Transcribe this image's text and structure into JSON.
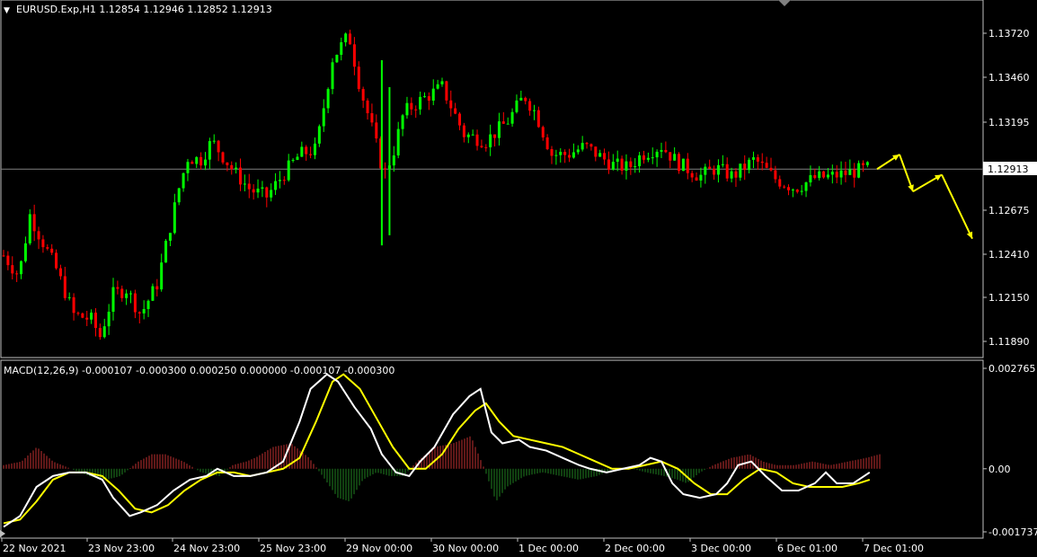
{
  "colors": {
    "background": "#000000",
    "frame": "#c0c0c0",
    "bull": "#00ff00",
    "bear": "#ff0000",
    "macd_line": "#ffffff",
    "signal_line": "#ffff00",
    "hist_up": "#c03030",
    "hist_down": "#208020",
    "arrow": "#ffff00",
    "price_line": "#808080"
  },
  "price_panel": {
    "header": "EURUSD.Exp,H1  1.12854 1.12946 1.12852 1.12913",
    "current_price": "1.12913",
    "y_ticks": [
      "1.13720",
      "1.13460",
      "1.13195",
      "1.12913",
      "1.12675",
      "1.12410",
      "1.12150",
      "1.11890"
    ]
  },
  "macd_panel": {
    "header": "MACD(12,26,9) -0.000107 -0.000300 0.000250 0.000000 -0.000107 -0.000300",
    "y_ticks": [
      "0.002765",
      "0.00",
      "-0.001737"
    ]
  },
  "x_ticks": [
    "22 Nov 2021",
    "23 Nov 23:00",
    "24 Nov 23:00",
    "25 Nov 23:00",
    "29 Nov 00:00",
    "30 Nov 00:00",
    "1 Dec 00:00",
    "2 Dec 00:00",
    "3 Dec 00:00",
    "6 Dec 01:00",
    "7 Dec 01:00"
  ],
  "chart_data": {
    "type": "candlestick",
    "symbol": "EURUSD.Exp",
    "timeframe": "H1",
    "ohlc_last": {
      "open": 1.12854,
      "high": 1.12946,
      "low": 1.12852,
      "close": 1.12913
    },
    "price_ylim": [
      1.1182,
      1.139
    ],
    "close_path": [
      [
        0,
        1.124
      ],
      [
        14,
        1.1228
      ],
      [
        24,
        1.1264
      ],
      [
        32,
        1.1253
      ],
      [
        48,
        1.1232
      ],
      [
        64,
        1.1205
      ],
      [
        80,
        1.1202
      ],
      [
        88,
        1.1192
      ],
      [
        100,
        1.1217
      ],
      [
        112,
        1.122
      ],
      [
        125,
        1.1205
      ],
      [
        140,
        1.1223
      ],
      [
        160,
        1.128
      ],
      [
        168,
        1.1298
      ],
      [
        180,
        1.1297
      ],
      [
        190,
        1.1308
      ],
      [
        210,
        1.129
      ],
      [
        225,
        1.1279
      ],
      [
        240,
        1.1275
      ],
      [
        255,
        1.1288
      ],
      [
        270,
        1.13
      ],
      [
        285,
        1.1303
      ],
      [
        300,
        1.1357
      ],
      [
        315,
        1.1371
      ],
      [
        325,
        1.134
      ],
      [
        335,
        1.1318
      ],
      [
        347,
        1.1288
      ],
      [
        355,
        1.13
      ],
      [
        365,
        1.1325
      ],
      [
        380,
        1.1332
      ],
      [
        400,
        1.134
      ],
      [
        420,
        1.1312
      ],
      [
        440,
        1.1308
      ],
      [
        460,
        1.132
      ],
      [
        475,
        1.1335
      ],
      [
        485,
        1.1325
      ],
      [
        500,
        1.13
      ],
      [
        515,
        1.13
      ],
      [
        530,
        1.1305
      ],
      [
        555,
        1.1294
      ],
      [
        570,
        1.1292
      ],
      [
        582,
        1.13
      ],
      [
        600,
        1.1305
      ],
      [
        615,
        1.1295
      ],
      [
        635,
        1.1287
      ],
      [
        650,
        1.1292
      ],
      [
        665,
        1.1287
      ],
      [
        685,
        1.1297
      ],
      [
        705,
        1.1285
      ],
      [
        722,
        1.128
      ],
      [
        740,
        1.1286
      ],
      [
        755,
        1.1287
      ],
      [
        770,
        1.1289
      ],
      [
        790,
        1.1292
      ]
    ],
    "shadow_spikes": [
      {
        "t": 345,
        "low": 1.1246,
        "high": 1.1356
      },
      {
        "t": 352,
        "low": 1.1252,
        "high": 1.134
      }
    ],
    "macd": {
      "params": "MACD(12,26,9)",
      "ylim": [
        -0.001737,
        0.002765
      ],
      "macd_line": [
        [
          0,
          -0.0016
        ],
        [
          15,
          -0.0013
        ],
        [
          30,
          -0.0005
        ],
        [
          45,
          -0.0002
        ],
        [
          60,
          -0.0001
        ],
        [
          75,
          -0.0001
        ],
        [
          90,
          -0.0003
        ],
        [
          100,
          -0.0008
        ],
        [
          115,
          -0.0013
        ],
        [
          125,
          -0.0012
        ],
        [
          140,
          -0.001
        ],
        [
          155,
          -0.0006
        ],
        [
          170,
          -0.0003
        ],
        [
          185,
          -0.0002
        ],
        [
          195,
          0.0
        ],
        [
          210,
          -0.0002
        ],
        [
          225,
          -0.0002
        ],
        [
          240,
          -0.0001
        ],
        [
          255,
          0.0002
        ],
        [
          270,
          0.0013
        ],
        [
          280,
          0.0022
        ],
        [
          295,
          0.0026
        ],
        [
          305,
          0.0024
        ],
        [
          320,
          0.0017
        ],
        [
          335,
          0.0011
        ],
        [
          345,
          0.0004
        ],
        [
          358,
          -0.0001
        ],
        [
          370,
          -0.0002
        ],
        [
          380,
          0.0002
        ],
        [
          393,
          0.0006
        ],
        [
          410,
          0.0015
        ],
        [
          425,
          0.002
        ],
        [
          435,
          0.0022
        ],
        [
          445,
          0.001
        ],
        [
          455,
          0.0007
        ],
        [
          470,
          0.0008
        ],
        [
          480,
          0.0006
        ],
        [
          495,
          0.0005
        ],
        [
          510,
          0.0003
        ],
        [
          525,
          0.0001
        ],
        [
          535,
          0.0
        ],
        [
          550,
          -0.0001
        ],
        [
          565,
          0.0
        ],
        [
          580,
          0.0001
        ],
        [
          590,
          0.0003
        ],
        [
          600,
          0.0002
        ],
        [
          610,
          -0.0004
        ],
        [
          620,
          -0.0007
        ],
        [
          635,
          -0.0008
        ],
        [
          650,
          -0.0007
        ],
        [
          660,
          -0.0004
        ],
        [
          670,
          0.0001
        ],
        [
          682,
          0.0002
        ],
        [
          695,
          -0.0002
        ],
        [
          710,
          -0.0006
        ],
        [
          725,
          -0.0006
        ],
        [
          740,
          -0.0004
        ],
        [
          750,
          -0.0001
        ],
        [
          760,
          -0.0004
        ],
        [
          775,
          -0.0004
        ],
        [
          790,
          -0.0001
        ]
      ],
      "signal_line": [
        [
          0,
          -0.0015
        ],
        [
          15,
          -0.0014
        ],
        [
          30,
          -0.0009
        ],
        [
          45,
          -0.0003
        ],
        [
          60,
          -0.0001
        ],
        [
          75,
          -0.0001
        ],
        [
          90,
          -0.0002
        ],
        [
          105,
          -0.0006
        ],
        [
          120,
          -0.0011
        ],
        [
          135,
          -0.0012
        ],
        [
          150,
          -0.001
        ],
        [
          165,
          -0.0006
        ],
        [
          180,
          -0.0003
        ],
        [
          195,
          -0.0001
        ],
        [
          210,
          -0.0001
        ],
        [
          225,
          -0.0002
        ],
        [
          240,
          -0.0001
        ],
        [
          255,
          0.0
        ],
        [
          270,
          0.0003
        ],
        [
          285,
          0.0013
        ],
        [
          300,
          0.0024
        ],
        [
          310,
          0.0026
        ],
        [
          325,
          0.0022
        ],
        [
          340,
          0.0014
        ],
        [
          355,
          0.0006
        ],
        [
          370,
          0.0
        ],
        [
          385,
          0.0
        ],
        [
          400,
          0.0004
        ],
        [
          415,
          0.0011
        ],
        [
          430,
          0.0016
        ],
        [
          440,
          0.0018
        ],
        [
          452,
          0.0013
        ],
        [
          465,
          0.0009
        ],
        [
          480,
          0.0008
        ],
        [
          495,
          0.0007
        ],
        [
          510,
          0.0006
        ],
        [
          525,
          0.0004
        ],
        [
          540,
          0.0002
        ],
        [
          555,
          0.0
        ],
        [
          570,
          0.0
        ],
        [
          585,
          0.0001
        ],
        [
          600,
          0.0002
        ],
        [
          615,
          0.0
        ],
        [
          630,
          -0.0004
        ],
        [
          645,
          -0.0007
        ],
        [
          660,
          -0.0007
        ],
        [
          675,
          -0.0003
        ],
        [
          690,
          0.0
        ],
        [
          705,
          -0.0001
        ],
        [
          720,
          -0.0004
        ],
        [
          735,
          -0.0005
        ],
        [
          750,
          -0.0005
        ],
        [
          765,
          -0.0005
        ],
        [
          780,
          -0.0004
        ],
        [
          790,
          -0.0003
        ]
      ],
      "histogram_envelope": [
        [
          0,
          0.0001
        ],
        [
          20,
          0.0002
        ],
        [
          37,
          0.0006
        ],
        [
          55,
          0.0002
        ],
        [
          75,
          0.0
        ],
        [
          95,
          -0.0002
        ],
        [
          115,
          -0.0003
        ],
        [
          130,
          -0.0002
        ],
        [
          150,
          0.0002
        ],
        [
          165,
          0.0004
        ],
        [
          180,
          0.0004
        ],
        [
          200,
          0.0002
        ],
        [
          220,
          -0.0001
        ],
        [
          240,
          -0.0002
        ],
        [
          255,
          0.0001
        ],
        [
          270,
          0.0002
        ],
        [
          280,
          0.0003
        ],
        [
          300,
          0.0006
        ],
        [
          320,
          0.0007
        ],
        [
          340,
          0.0003
        ],
        [
          355,
          -0.0002
        ],
        [
          372,
          -0.0008
        ],
        [
          385,
          -0.0009
        ],
        [
          400,
          -0.0003
        ],
        [
          415,
          -0.0001
        ],
        [
          430,
          -0.0002
        ],
        [
          445,
          -0.0002
        ],
        [
          460,
          0.0002
        ],
        [
          480,
          0.0006
        ],
        [
          500,
          0.0007
        ],
        [
          520,
          0.0009
        ],
        [
          535,
          0.0
        ],
        [
          548,
          -0.0009
        ],
        [
          560,
          -0.0005
        ],
        [
          580,
          -0.0002
        ],
        [
          600,
          -0.0001
        ],
        [
          620,
          -0.0002
        ],
        [
          640,
          -0.0003
        ],
        [
          660,
          -0.0002
        ],
        [
          680,
          0.0
        ],
        [
          700,
          0.0
        ],
        [
          715,
          -0.0001
        ],
        [
          735,
          -0.0002
        ],
        [
          750,
          -0.0003
        ],
        [
          760,
          -0.0004
        ],
        [
          775,
          -0.0001
        ],
        [
          790,
          0.0001
        ],
        [
          810,
          0.0003
        ],
        [
          830,
          0.0004
        ],
        [
          845,
          0.0002
        ],
        [
          860,
          0.0001
        ],
        [
          880,
          0.0001
        ],
        [
          900,
          0.0002
        ],
        [
          920,
          0.0001
        ],
        [
          940,
          0.0002
        ],
        [
          960,
          0.0003
        ],
        [
          975,
          0.0004
        ]
      ]
    },
    "forecast_arrows": [
      [
        1.12913,
        1.13
      ],
      [
        1.13,
        1.1278
      ],
      [
        1.1278,
        1.1288
      ],
      [
        1.1288,
        1.125
      ]
    ]
  }
}
